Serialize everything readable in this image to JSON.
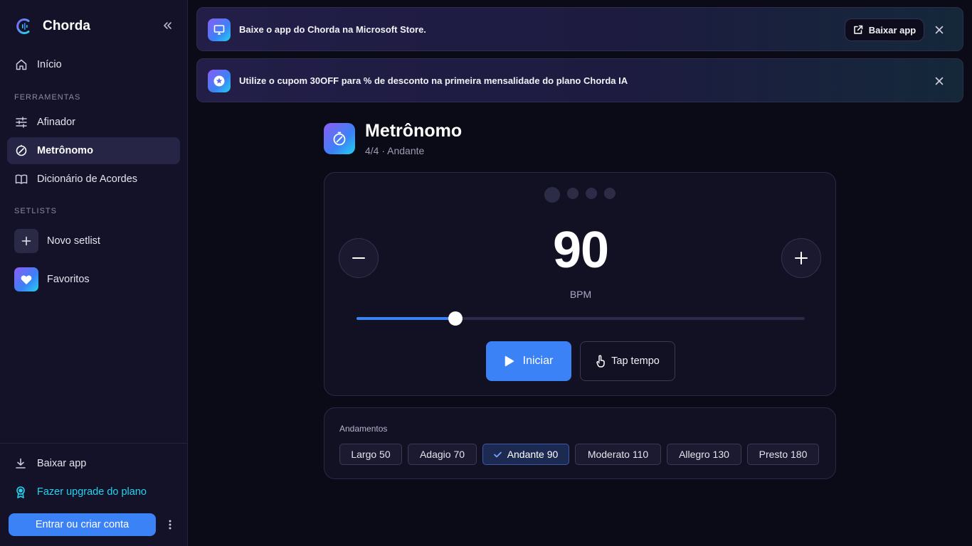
{
  "app": {
    "name": "Chorda"
  },
  "sidebar": {
    "home_label": "Início",
    "tools_section": "FERRAMENTAS",
    "tools": [
      {
        "label": "Afinador",
        "icon": "sliders-icon"
      },
      {
        "label": "Metrônomo",
        "icon": "metronome-icon",
        "active": true
      },
      {
        "label": "Dicionário de Acordes",
        "icon": "book-icon"
      }
    ],
    "setlists_section": "SETLISTS",
    "new_setlist_label": "Novo setlist",
    "favorites_label": "Favoritos",
    "download_label": "Baixar app",
    "upgrade_label": "Fazer upgrade do plano",
    "login_label": "Entrar ou criar conta"
  },
  "banners": [
    {
      "text": "Baixe o app do Chorda na Microsoft Store.",
      "action_label": "Baixar app",
      "icon": "monitor-icon"
    },
    {
      "text": "Utilize o cupom 30OFF para % de desconto na primeira mensalidade do plano Chorda IA",
      "icon": "badge-icon"
    }
  ],
  "metronome": {
    "title": "Metrônomo",
    "subtitle": "4/4 · Andante",
    "bpm": "90",
    "bpm_label": "BPM",
    "slider_fraction": 0.22,
    "beats": 4,
    "start_label": "Iniciar",
    "tap_label": "Tap tempo"
  },
  "tempos": {
    "label": "Andamentos",
    "items": [
      {
        "label": "Largo 50"
      },
      {
        "label": "Adagio 70"
      },
      {
        "label": "Andante 90",
        "selected": true
      },
      {
        "label": "Moderato 110"
      },
      {
        "label": "Allegro 130"
      },
      {
        "label": "Presto 180"
      }
    ]
  },
  "colors": {
    "accent": "#3b82f6",
    "upgrade": "#22d3ee",
    "background": "#0b0b18",
    "sidebar": "#131228"
  }
}
